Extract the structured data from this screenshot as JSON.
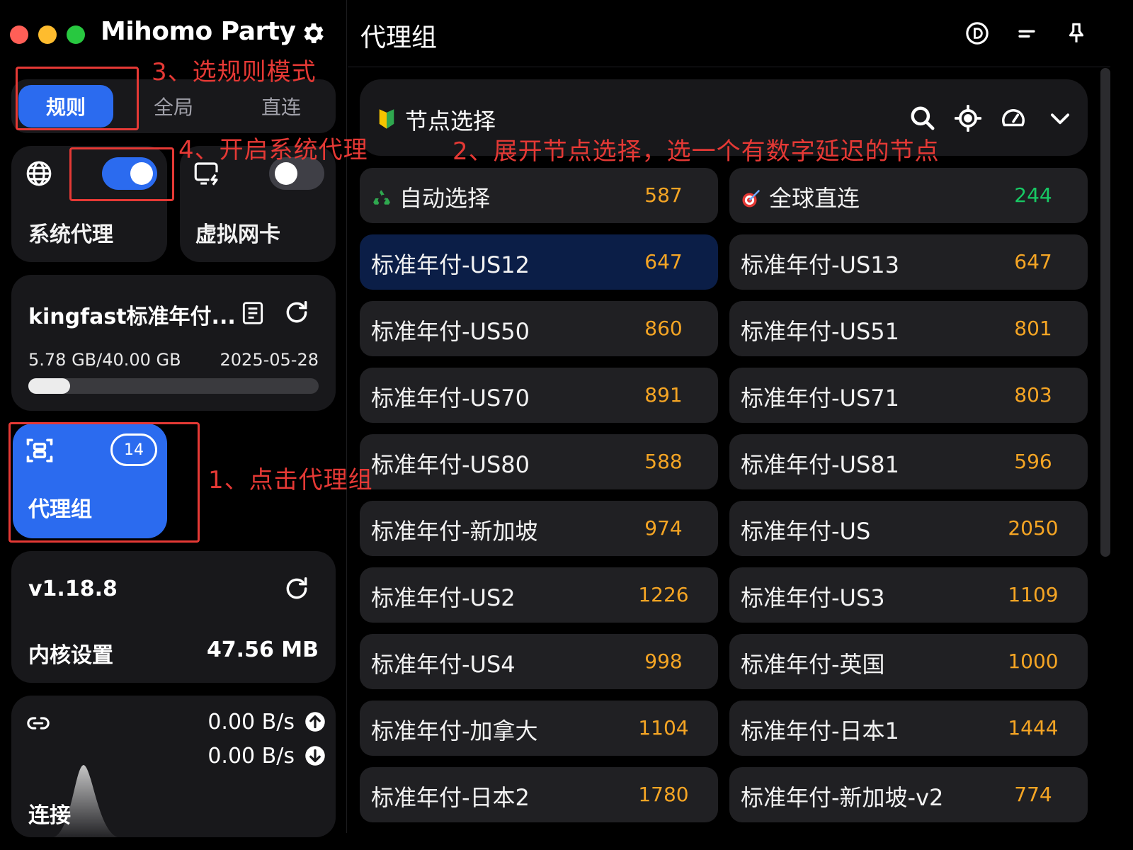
{
  "app": {
    "title": "Mihomo Party"
  },
  "mode_tabs": [
    {
      "label": "规则",
      "active": true
    },
    {
      "label": "全局",
      "active": false
    },
    {
      "label": "直连",
      "active": false
    }
  ],
  "sysproxy": {
    "label": "系统代理",
    "enabled": true
  },
  "tun": {
    "label": "虚拟网卡",
    "enabled": false
  },
  "profile": {
    "name": "kingfast标准年付...",
    "usage": "5.78 GB/40.00 GB",
    "expire": "2025-05-28",
    "usage_fraction": 0.145
  },
  "proxy_nav": {
    "label": "代理组",
    "count": "14"
  },
  "core": {
    "version": "v1.18.8",
    "label": "内核设置",
    "memory": "47.56 MB"
  },
  "connections": {
    "label": "连接",
    "upload": "0.00 B/s",
    "download": "0.00 B/s"
  },
  "main": {
    "title": "代理组",
    "group": {
      "name": "节点选择"
    }
  },
  "proxies": [
    {
      "name": "自动选择",
      "delay": "587",
      "icon": "recycle-icon"
    },
    {
      "name": "全球直连",
      "delay": "244",
      "icon": "target-icon",
      "color": "#17c964"
    },
    {
      "name": "标准年付-US12",
      "delay": "647",
      "selected": true
    },
    {
      "name": "标准年付-US13",
      "delay": "647"
    },
    {
      "name": "标准年付-US50",
      "delay": "860"
    },
    {
      "name": "标准年付-US51",
      "delay": "801"
    },
    {
      "name": "标准年付-US70",
      "delay": "891"
    },
    {
      "name": "标准年付-US71",
      "delay": "803"
    },
    {
      "name": "标准年付-US80",
      "delay": "588"
    },
    {
      "name": "标准年付-US81",
      "delay": "596"
    },
    {
      "name": "标准年付-新加坡",
      "delay": "974"
    },
    {
      "name": "标准年付-US",
      "delay": "2050"
    },
    {
      "name": "标准年付-US2",
      "delay": "1226"
    },
    {
      "name": "标准年付-US3",
      "delay": "1109"
    },
    {
      "name": "标准年付-US4",
      "delay": "998"
    },
    {
      "name": "标准年付-英国",
      "delay": "1000"
    },
    {
      "name": "标准年付-加拿大",
      "delay": "1104"
    },
    {
      "name": "标准年付-日本1",
      "delay": "1444"
    },
    {
      "name": "标准年付-日本2",
      "delay": "1780"
    },
    {
      "name": "标准年付-新加坡-v2",
      "delay": "774"
    }
  ],
  "annotations": {
    "step1": "1、点击代理组",
    "step2": "2、展开节点选择，选一个有数字延迟的节点",
    "step3": "3、选规则模式",
    "step4": "4、开启系统代理"
  },
  "colors": {
    "accent": "#2b6bef",
    "delay": "#f5a524",
    "delay_good": "#17c964",
    "annotation": "#e53935"
  }
}
